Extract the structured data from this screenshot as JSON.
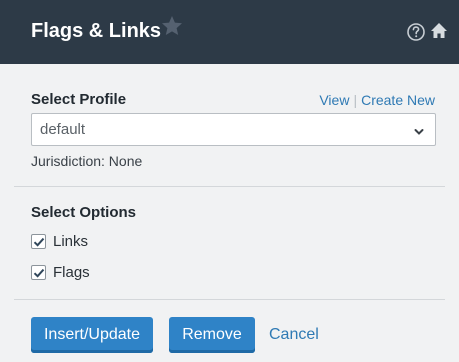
{
  "header": {
    "title": "Flags & Links",
    "favorite_icon": "star-icon",
    "help_icon": "question-circle-icon",
    "home_icon": "home-icon"
  },
  "profile": {
    "label": "Select Profile",
    "view_link": "View",
    "separator": "|",
    "create_link": "Create New",
    "selected_value": "default",
    "jurisdiction": "Jurisdiction: None"
  },
  "options": {
    "label": "Select Options",
    "items": [
      {
        "label": "Links",
        "checked": true
      },
      {
        "label": "Flags",
        "checked": true
      }
    ]
  },
  "actions": {
    "insert_label": "Insert/Update",
    "remove_label": "Remove",
    "cancel_label": "Cancel"
  },
  "colors": {
    "header_bg": "#2d3a47",
    "panel_bg": "#f1f2f3",
    "primary_button": "#2f83c7",
    "link": "#2f7ab4"
  }
}
